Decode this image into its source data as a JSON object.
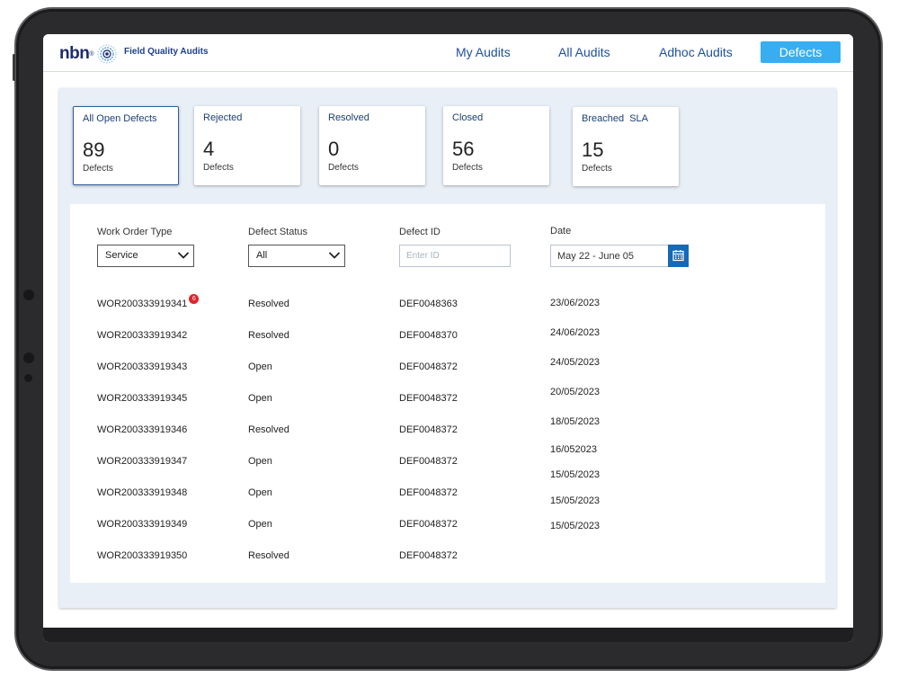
{
  "header": {
    "logo_text": "nbn",
    "logo_sup": "®",
    "app_title": "Field Quality Audits",
    "nav": [
      {
        "label": "My Audits"
      },
      {
        "label": "All Audits"
      },
      {
        "label": "Adhoc Audits"
      },
      {
        "label": "Defects"
      }
    ]
  },
  "summary_cards": [
    {
      "label": "All Open Defects",
      "value": "89",
      "unit": "Defects"
    },
    {
      "label": "Rejected",
      "value": "4",
      "unit": "Defects"
    },
    {
      "label": "Resolved",
      "value": "0",
      "unit": "Defects"
    },
    {
      "label": "Closed",
      "value": "56",
      "unit": "Defects"
    },
    {
      "label": "Breached  SLA",
      "value": "15",
      "unit": "Defects"
    }
  ],
  "filters": {
    "work_order_type": {
      "label": "Work Order Type",
      "value": "Service"
    },
    "defect_status": {
      "label": "Defect Status",
      "value": "All"
    },
    "defect_id": {
      "label": "Defect ID",
      "placeholder": "Enter ID"
    },
    "date": {
      "label": "Date",
      "value": "May 22 - June 05"
    }
  },
  "rows": [
    {
      "work_order": "WOR200333919341",
      "badge": "6",
      "status": "Resolved",
      "defect_id": "DEF0048363",
      "date": "23/06/2023"
    },
    {
      "work_order": "WOR200333919342",
      "status": "Resolved",
      "defect_id": "DEF0048370",
      "date": "24/06/2023"
    },
    {
      "work_order": "WOR200333919343",
      "status": "Open",
      "defect_id": "DEF0048372",
      "date": "24/05/2023"
    },
    {
      "work_order": "WOR200333919345",
      "status": "Open",
      "defect_id": "DEF0048372",
      "date": "20/05/2023"
    },
    {
      "work_order": "WOR200333919346",
      "status": "Resolved",
      "defect_id": "DEF0048372",
      "date": "18/05/2023"
    },
    {
      "work_order": "WOR200333919347",
      "status": "Open",
      "defect_id": "DEF0048372",
      "date": "16/052023"
    },
    {
      "work_order": "WOR200333919348",
      "status": "Open",
      "defect_id": "DEF0048372",
      "date": "15/05/2023"
    },
    {
      "work_order": "WOR200333919349",
      "status": "Open",
      "defect_id": "DEF0048372",
      "date": "15/05/2023"
    },
    {
      "work_order": "WOR200333919350",
      "status": "Resolved",
      "defect_id": "DEF0048372",
      "date": "15/05/2023"
    }
  ],
  "icons": {
    "logo": "nbn-logo-icon",
    "dropdown": "chevron-down-icon",
    "calendar": "calendar-icon",
    "notification": "badge"
  },
  "colors": {
    "accent": "#37aef2",
    "nav_text": "#1d4f9c",
    "calendar_button": "#1769b4",
    "badge": "#e2232a",
    "panel_bg": "#e9eff7"
  }
}
